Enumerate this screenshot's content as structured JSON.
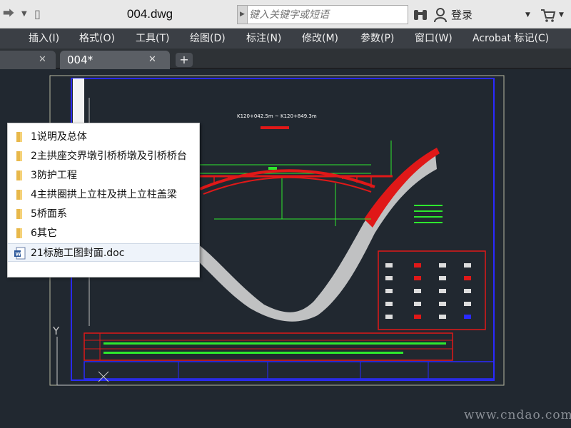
{
  "titlebar": {
    "title": "004.dwg",
    "search_placeholder": "键入关键字或短语",
    "login": "登录"
  },
  "menu": [
    "插入(I)",
    "格式(O)",
    "工具(T)",
    "绘图(D)",
    "标注(N)",
    "修改(M)",
    "参数(P)",
    "窗口(W)",
    "Acrobat 标记(C)"
  ],
  "tabs": {
    "active": "004*"
  },
  "drawing": {
    "chainage": "K120+042.5m ~ K120+849.3m",
    "ucs_y": "Y"
  },
  "popup": {
    "items": [
      {
        "label": "1说明及总体",
        "icon": "folder-icon"
      },
      {
        "label": "2主拱座交界墩引桥桥墩及引桥桥台",
        "icon": "folder-icon"
      },
      {
        "label": "3防护工程",
        "icon": "folder-icon"
      },
      {
        "label": "4主拱圈拱上立柱及拱上立柱盖梁",
        "icon": "folder-icon"
      },
      {
        "label": "5桥面系",
        "icon": "folder-icon"
      },
      {
        "label": "6其它",
        "icon": "folder-icon"
      },
      {
        "label": "21标施工图封面.doc",
        "icon": "word-doc-icon"
      }
    ]
  },
  "watermark": "www.cndao.com",
  "colors": {
    "menu_bg": "#3b3f45",
    "canvas_bg": "#212830",
    "frame_blue": "#2a2aff",
    "arch_red": "#e01818",
    "dim_green": "#2ee82e"
  }
}
